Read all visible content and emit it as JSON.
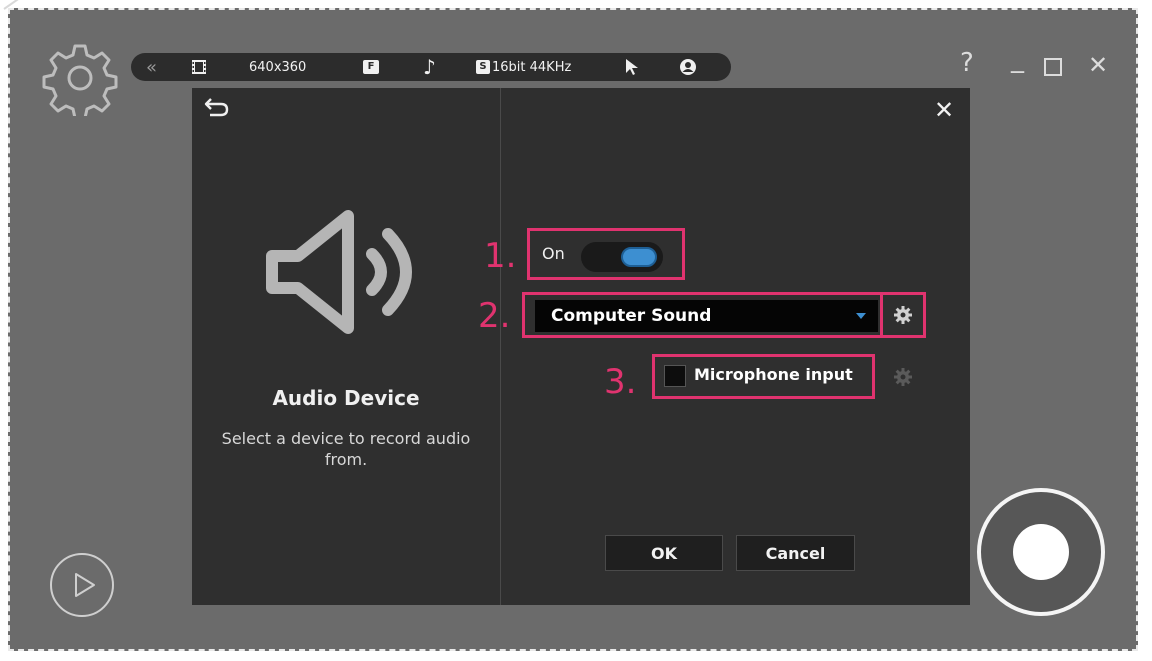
{
  "toolbar": {
    "collapse_icon": "double-chevron-left-icon",
    "video_icon": "film-strip-icon",
    "resolution": "640x360",
    "frames_badge": "F",
    "audio_icon": "music-note-icon",
    "audio_badge": "S",
    "audio_quality": "16bit 44KHz",
    "cursor_icon": "cursor-arrow-icon",
    "webcam_icon": "webcam-icon"
  },
  "window": {
    "help": "?",
    "minimize": "_",
    "maximize": "□",
    "close": "✕"
  },
  "dialog": {
    "close": "✕",
    "title": "Audio Device",
    "description": "Select a device to record audio from.",
    "toggle_label": "On",
    "toggle_state": "on",
    "device_selected": "Computer Sound",
    "microphone_label": "Microphone input",
    "microphone_checked": false,
    "ok_label": "OK",
    "cancel_label": "Cancel"
  },
  "annotations": {
    "step1": "1.",
    "step2": "2.",
    "step3": "3."
  },
  "colors": {
    "highlight": "#e0336f",
    "accent": "#3d8fd1",
    "frame_bg": "#6b6b6b",
    "dialog_bg": "#2f2f2f"
  }
}
